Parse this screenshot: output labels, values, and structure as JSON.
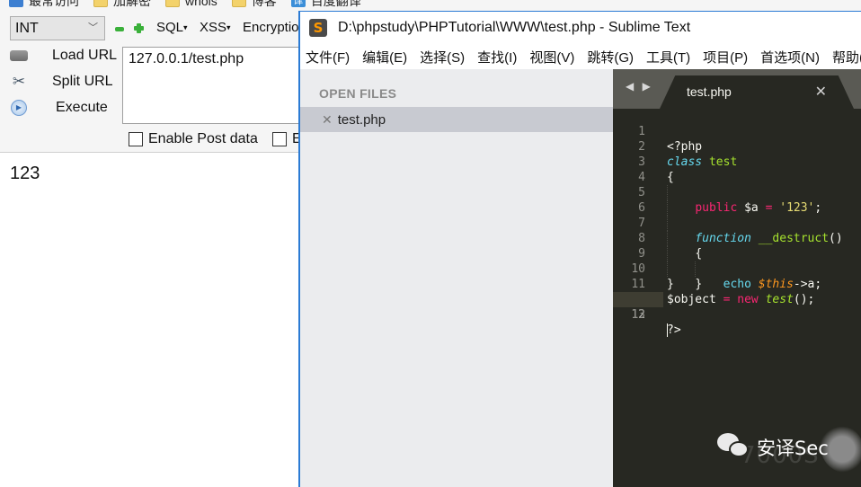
{
  "browser": {
    "bookmarks": [
      {
        "label": "最常访问",
        "icon": "most-visited-icon"
      },
      {
        "label": "加解密",
        "icon": "folder-icon"
      },
      {
        "label": "whois",
        "icon": "folder-icon"
      },
      {
        "label": "博客",
        "icon": "folder-icon"
      },
      {
        "label": "百度翻译",
        "icon": "translate-icon"
      }
    ],
    "hackbar": {
      "select_value": "INT",
      "toolbar": {
        "sql_label": "SQL",
        "xss_label": "XSS",
        "encryption_label": "Encryptio"
      },
      "actions": {
        "load_url": "Load URL",
        "split_url": "Split URL",
        "execute": "Execute"
      },
      "url_value": "127.0.0.1/test.php",
      "enable_post_label": "Enable Post data",
      "enable_referrer_label": "E"
    },
    "page_output": "123"
  },
  "sublime": {
    "title": "D:\\phpstudy\\PHPTutorial\\WWW\\test.php - Sublime Text",
    "menu": [
      "文件(F)",
      "编辑(E)",
      "选择(S)",
      "查找(I)",
      "视图(V)",
      "跳转(G)",
      "工具(T)",
      "项目(P)",
      "首选项(N)",
      "帮助("
    ],
    "sidebar": {
      "heading": "OPEN FILES",
      "files": [
        "test.php"
      ]
    },
    "tab": {
      "label": "test.php",
      "close": "✕"
    },
    "nav_arrows": "◀ ▶",
    "line_numbers": [
      "1",
      "2",
      "3",
      "4",
      "5",
      "6",
      "7",
      "8",
      "9",
      "10",
      "11",
      "12",
      "13"
    ],
    "code": {
      "l1": "<?php",
      "l2_kw": "class",
      "l2_name": "test",
      "l3": "{",
      "l4_kw": "public",
      "l4_var": "$a",
      "l4_op": "=",
      "l4_str": "'123'",
      "l4_end": ";",
      "l6_kw": "function",
      "l6_name": "__destruct",
      "l6_paren": "()",
      "l7": "{",
      "l8_kw": "echo",
      "l8_var": "$this",
      "l8_rest": "->a;",
      "l9": "}",
      "l10": "}",
      "l11_var": "$object",
      "l11_op": "=",
      "l11_new": "new",
      "l11_cls": "test",
      "l11_end": "();",
      "l13": "?>"
    },
    "active_line": 12
  },
  "watermark": {
    "text": "安译Sec",
    "ghost": "7000S"
  },
  "colors": {
    "editor_bg": "#272822",
    "keyword": "#f92672",
    "storage": "#66d9ef",
    "entity": "#a6e22e",
    "string": "#e6db74",
    "variable": "#fd971f",
    "window_accent": "#2b7bd4"
  }
}
